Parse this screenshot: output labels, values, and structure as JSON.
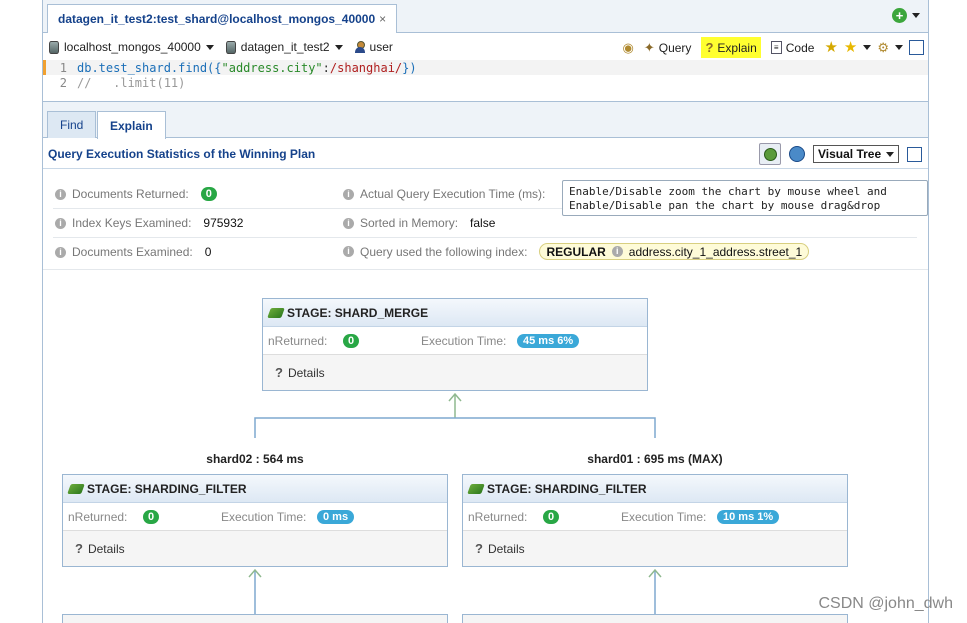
{
  "document_tab": {
    "title": "datagen_it_test2:test_shard@localhost_mongos_40000",
    "close": "×"
  },
  "toolbar": {
    "connection": "localhost_mongos_40000",
    "database": "datagen_it_test2",
    "user": "user",
    "query_label": "Query",
    "explain_label": "Explain",
    "code_label": "Code"
  },
  "editor": {
    "lines": [
      {
        "num": "1",
        "obj": "db.test_shard.find({",
        "key": "\"address.city\"",
        "colon": ":",
        "regex": "/shanghai/",
        "close": "})"
      },
      {
        "num": "2",
        "comment": "//   .limit(11)"
      }
    ]
  },
  "subtabs": {
    "find": "Find",
    "explain": "Explain"
  },
  "panel": {
    "title": "Query Execution Statistics of the Winning Plan",
    "view_select": "Visual Tree"
  },
  "tooltip": {
    "line1": "Enable/Disable zoom the chart by mouse wheel and",
    "line2": "Enable/Disable pan the chart by mouse drag&drop"
  },
  "stats": {
    "docs_returned_label": "Documents Returned:",
    "docs_returned": "0",
    "actual_time_label": "Actual Query Execution Time (ms):",
    "keys_examined_label": "Index Keys Examined:",
    "keys_examined": "975932",
    "sorted_label": "Sorted in Memory:",
    "sorted": "false",
    "docs_examined_label": "Documents Examined:",
    "docs_examined": "0",
    "index_label": "Query used the following index:",
    "index_type": "REGULAR",
    "index_name": "address.city_1_address.street_1"
  },
  "tree": {
    "root": {
      "title": "STAGE: SHARD_MERGE",
      "nreturned_label": "nReturned:",
      "nreturned": "0",
      "time_label": "Execution Time:",
      "time": "45 ms  6%",
      "details": "Details"
    },
    "shards": [
      {
        "label": "shard02 : 564 ms",
        "title": "STAGE: SHARDING_FILTER",
        "nreturned_label": "nReturned:",
        "nreturned": "0",
        "time_label": "Execution Time:",
        "time": "0 ms",
        "details": "Details"
      },
      {
        "label": "shard01 : 695 ms (MAX)",
        "title": "STAGE: SHARDING_FILTER",
        "nreturned_label": "nReturned:",
        "nreturned": "0",
        "time_label": "Execution Time:",
        "time": "10 ms  1%",
        "details": "Details"
      }
    ]
  },
  "watermark": "CSDN @john_dwh",
  "colors": {
    "highlight": "#ffff30",
    "accent": "#15428b",
    "green": "#28a745",
    "blue_pill": "#3aa8d8",
    "arrow": "#c0101a"
  }
}
